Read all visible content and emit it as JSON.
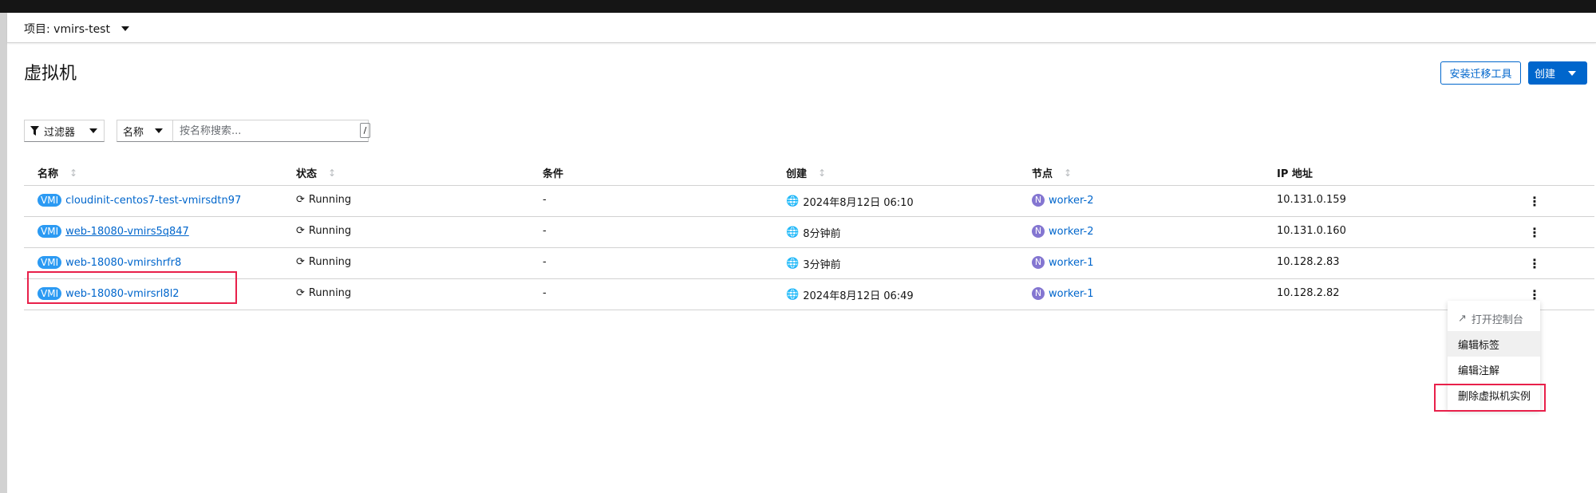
{
  "project": {
    "label": "项目: vmirs-test"
  },
  "page": {
    "title": "虚拟机"
  },
  "actions": {
    "install_tools": "安装迁移工具",
    "create": "创建"
  },
  "filters": {
    "filter_label": "过滤器",
    "name_label": "名称",
    "search_placeholder": "按名称搜索...",
    "shortcut": "/"
  },
  "table": {
    "columns": {
      "name": "名称",
      "status": "状态",
      "conditions": "条件",
      "created": "创建",
      "node": "节点",
      "ip": "IP 地址"
    },
    "rows": [
      {
        "badge": "VMI",
        "name": "cloudinit-centos7-test-vmirsdtn97",
        "status": "Running",
        "conditions": "-",
        "created": "2024年8月12日 06:10",
        "node_badge": "N",
        "node": "worker-2",
        "ip": "10.131.0.159"
      },
      {
        "badge": "VMI",
        "name": "web-18080-vmirs5q847",
        "status": "Running",
        "conditions": "-",
        "created": "8分钟前",
        "node_badge": "N",
        "node": "worker-2",
        "ip": "10.131.0.160"
      },
      {
        "badge": "VMI",
        "name": "web-18080-vmirshrfr8",
        "status": "Running",
        "conditions": "-",
        "created": "3分钟前",
        "node_badge": "N",
        "node": "worker-1",
        "ip": "10.128.2.83"
      },
      {
        "badge": "VMI",
        "name": "web-18080-vmirsrl8l2",
        "status": "Running",
        "conditions": "-",
        "created": "2024年8月12日 06:49",
        "node_badge": "N",
        "node": "worker-1",
        "ip": "10.128.2.82"
      }
    ]
  },
  "menu": {
    "open_console": "打开控制台",
    "edit_labels": "编辑标签",
    "edit_annotations": "编辑注解",
    "delete_vmi": "删除虚拟机实例"
  },
  "colors": {
    "primary": "#0066cc",
    "vmi_badge": "#2b9af3",
    "node_badge": "#8476d1",
    "highlight": "#e8204a"
  }
}
